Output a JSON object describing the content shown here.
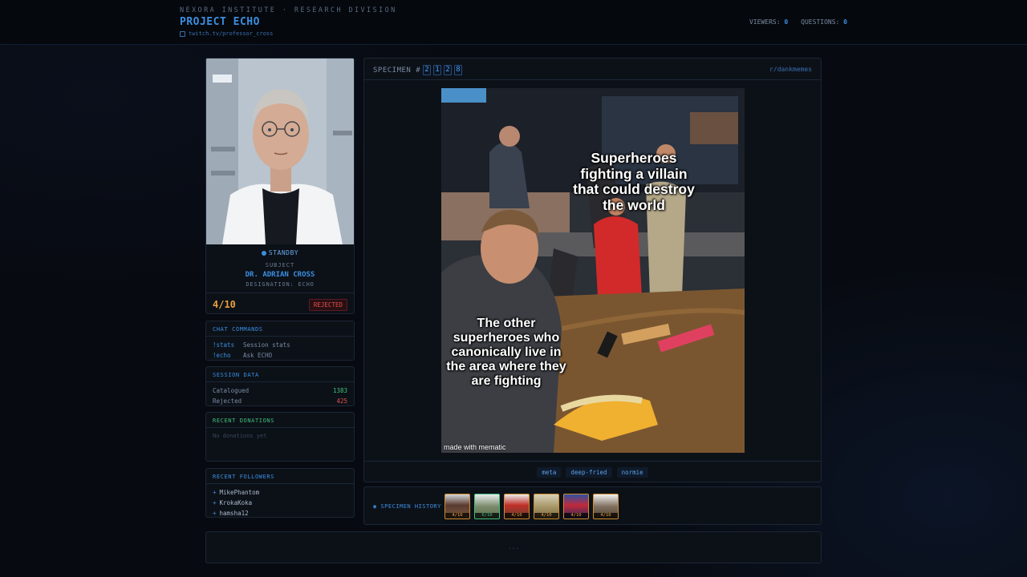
{
  "header": {
    "org": "NEXORA INSTITUTE · RESEARCH DIVISION",
    "project": "PROJECT ECHO",
    "twitch_link": "twitch.tv/professor_cross",
    "viewers_label": "VIEWERS:",
    "viewers_value": "0",
    "questions_label": "QUESTIONS:",
    "questions_value": "0"
  },
  "subject": {
    "status": "STANDBY",
    "label": "SUBJECT",
    "name": "DR. ADRIAN CROSS",
    "designation": "DESIGNATION: ECHO",
    "score": "4/10",
    "verdict": "REJECTED"
  },
  "chat_commands": {
    "title": "CHAT COMMANDS",
    "items": [
      {
        "cmd": "!stats",
        "desc": "Session stats"
      },
      {
        "cmd": "!echo",
        "desc": "Ask ECHO"
      }
    ]
  },
  "session_data": {
    "title": "SESSION DATA",
    "catalogued_label": "Catalogued",
    "catalogued_value": "1383",
    "rejected_label": "Rejected",
    "rejected_value": "425"
  },
  "donations": {
    "title": "RECENT DONATIONS",
    "empty": "No donations yet"
  },
  "followers": {
    "title": "RECENT FOLLOWERS",
    "items": [
      "MikePhantom",
      "KrokaKoka",
      "hamsha12"
    ]
  },
  "specimen": {
    "label": "SPECIMEN #",
    "digits": [
      "2",
      "1",
      "2",
      "8"
    ],
    "subreddit": "r/dankmemes",
    "caption_top": "Superheroes fighting a villain that could destroy the world",
    "caption_bottom": "The other superheroes who canonically live in the area where they are fighting",
    "watermark": "made with mematic",
    "tags": [
      "meta",
      "deep-fried",
      "normie"
    ]
  },
  "history": {
    "label": "◉ SPECIMEN HISTORY",
    "items": [
      {
        "score": "4/10",
        "status": "rejected"
      },
      {
        "score": "6/10",
        "status": "accepted"
      },
      {
        "score": "4/10",
        "status": "rejected"
      },
      {
        "score": "4/10",
        "status": "rejected"
      },
      {
        "score": "4/10",
        "status": "rejected"
      },
      {
        "score": "4/10",
        "status": "rejected"
      }
    ]
  },
  "footer": {
    "text": "..."
  },
  "colors": {
    "accent": "#3b8ee0",
    "score": "#e8a040",
    "rejected": "#e05050",
    "positive": "#3fbf7a",
    "background": "#070a10"
  }
}
